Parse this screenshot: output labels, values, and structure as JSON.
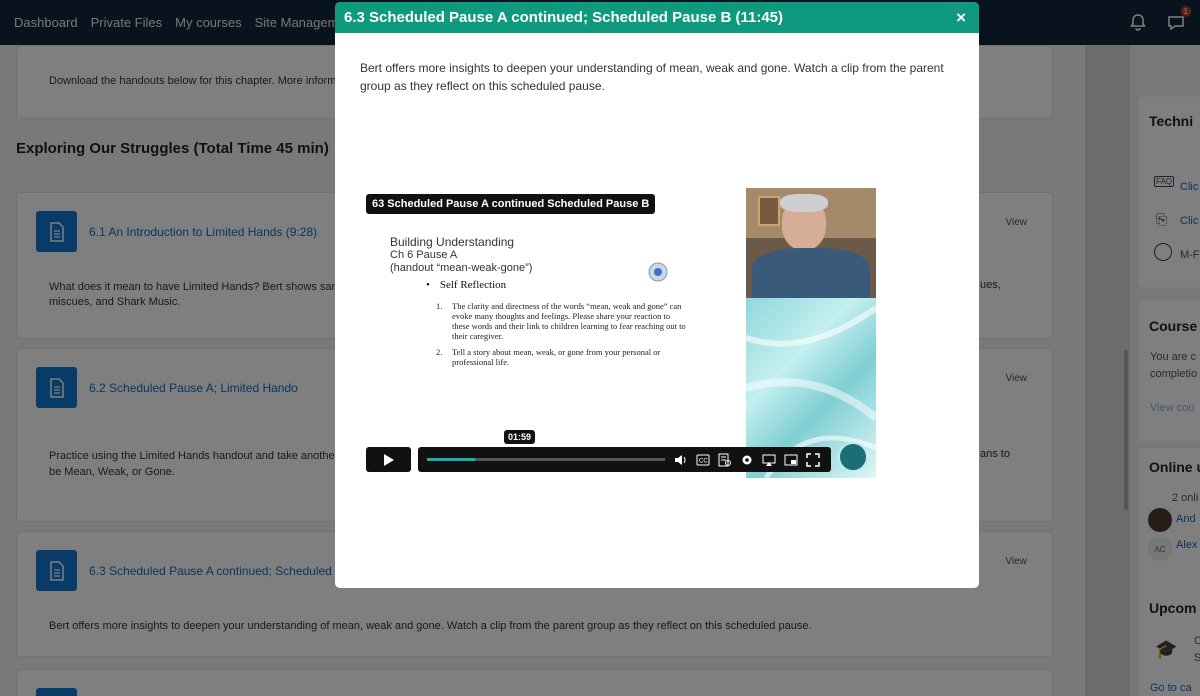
{
  "navbar": {
    "links": [
      "Dashboard",
      "Private Files",
      "My courses",
      "Site Management"
    ],
    "message_badge": "1"
  },
  "main": {
    "top_card_text": "Download the handouts below for this chapter. More inform",
    "section_title": "Exploring Our Struggles (Total Time 45 min)",
    "activities": [
      {
        "title": "6.1 An Introduction to Limited Hands (9:28)",
        "summary_left": "What does it mean to have Limited Hands? Bert shows sam",
        "summary_left2": "miscues, and Shark Music.",
        "summary_right": "ues,",
        "view": "View"
      },
      {
        "title": "6.2 Scheduled Pause A; Limited Hando",
        "summary_left": "Practice using the Limited Hands handout and take another",
        "summary_left2": "be Mean, Weak, or Gone.",
        "summary_right": "ans to",
        "view": "View"
      },
      {
        "title": "6.3 Scheduled Pause A continued; Scheduled",
        "summary_left": "Bert offers more insights to deepen your understanding of mean, weak and gone. Watch a clip from the parent group as they reflect on this scheduled pause.",
        "view": "View"
      }
    ]
  },
  "sidebar": {
    "technical_title": "Techni",
    "tech_links": [
      "Clic",
      "Clic",
      "M-F"
    ],
    "course_title": "Course",
    "course_text1": "You are c",
    "course_text2": "completio",
    "course_link": "View cou",
    "online_title": "Online u",
    "online_count": "2 onli",
    "online_users": [
      "And",
      "Alex"
    ],
    "online_initials": "AC",
    "upcoming_title": "Upcom",
    "upcoming_item": "C",
    "upcoming_sub": "S",
    "go_to_calendar": "Go to ca"
  },
  "modal": {
    "title": "6.3 Scheduled Pause A continued; Scheduled Pause B (11:45)",
    "close": "×",
    "description": "Bert offers more insights to deepen your understanding of mean, weak and gone. Watch a clip from the parent group as they reflect on this scheduled pause."
  },
  "video": {
    "title": "63 Scheduled Pause A continued Scheduled Pause B",
    "slide_line1": "Building Understanding",
    "slide_line2": "Ch 6 Pause A",
    "slide_line3": "(handout “mean-weak-gone”)",
    "bullet": "Self Reflection",
    "items": [
      {
        "num": "1.",
        "text": "The clarity and directness of the words “mean, weak and gone” can evoke many thoughts and feelings. Please share your reaction to these words and their link to children learning to fear reaching out to their caregiver."
      },
      {
        "num": "2.",
        "text": "Tell a story about mean, weak, or gone from your personal or professional life."
      }
    ],
    "current_time": "01:59",
    "progress_fraction": 0.2,
    "controls": [
      "volume-icon",
      "cc-icon",
      "transcript-icon",
      "settings-icon",
      "airplay-icon",
      "pip-icon",
      "fullscreen-icon"
    ]
  },
  "colors": {
    "navbar": "#13263d",
    "modal_header": "#0f9a80",
    "link": "#0f6cbf",
    "progress": "#19b0a9"
  }
}
